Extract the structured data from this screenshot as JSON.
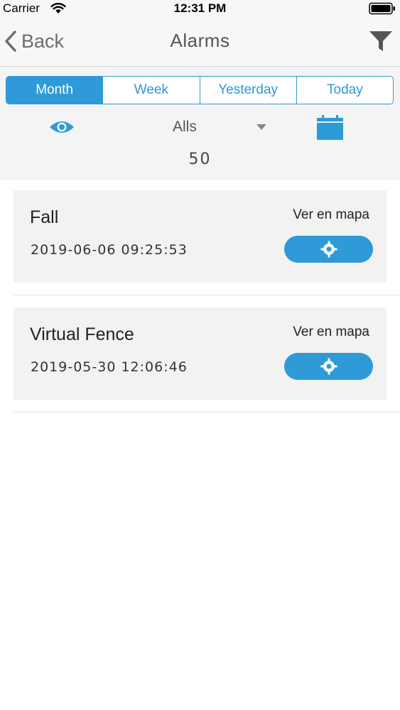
{
  "status_bar": {
    "carrier": "Carrier",
    "time": "12:31 PM"
  },
  "nav": {
    "back_label": "Back",
    "title": "Alarms",
    "icons": {
      "back": "chevron-left-icon",
      "filter": "funnel-filter-icon"
    }
  },
  "filters": {
    "periods": [
      {
        "label": "Month",
        "selected": true
      },
      {
        "label": "Week",
        "selected": false
      },
      {
        "label": "Yesterday",
        "selected": false
      },
      {
        "label": "Today",
        "selected": false
      }
    ],
    "type_select": "Alls",
    "count": "50",
    "icons": {
      "view": "eye-icon",
      "calendar": "calendar-icon",
      "dropdown": "caret-down-icon"
    }
  },
  "alarms": [
    {
      "title": "Fall",
      "datetime": "2019-06-06 09:25:53",
      "map_label": "Ver en mapa"
    },
    {
      "title": "Virtual Fence",
      "datetime": "2019-05-30 12:06:46",
      "map_label": "Ver en mapa"
    }
  ],
  "colors": {
    "accent": "#2e9ad7",
    "bar_background": "#f7f7f7",
    "card_background": "#f2f2f2"
  }
}
